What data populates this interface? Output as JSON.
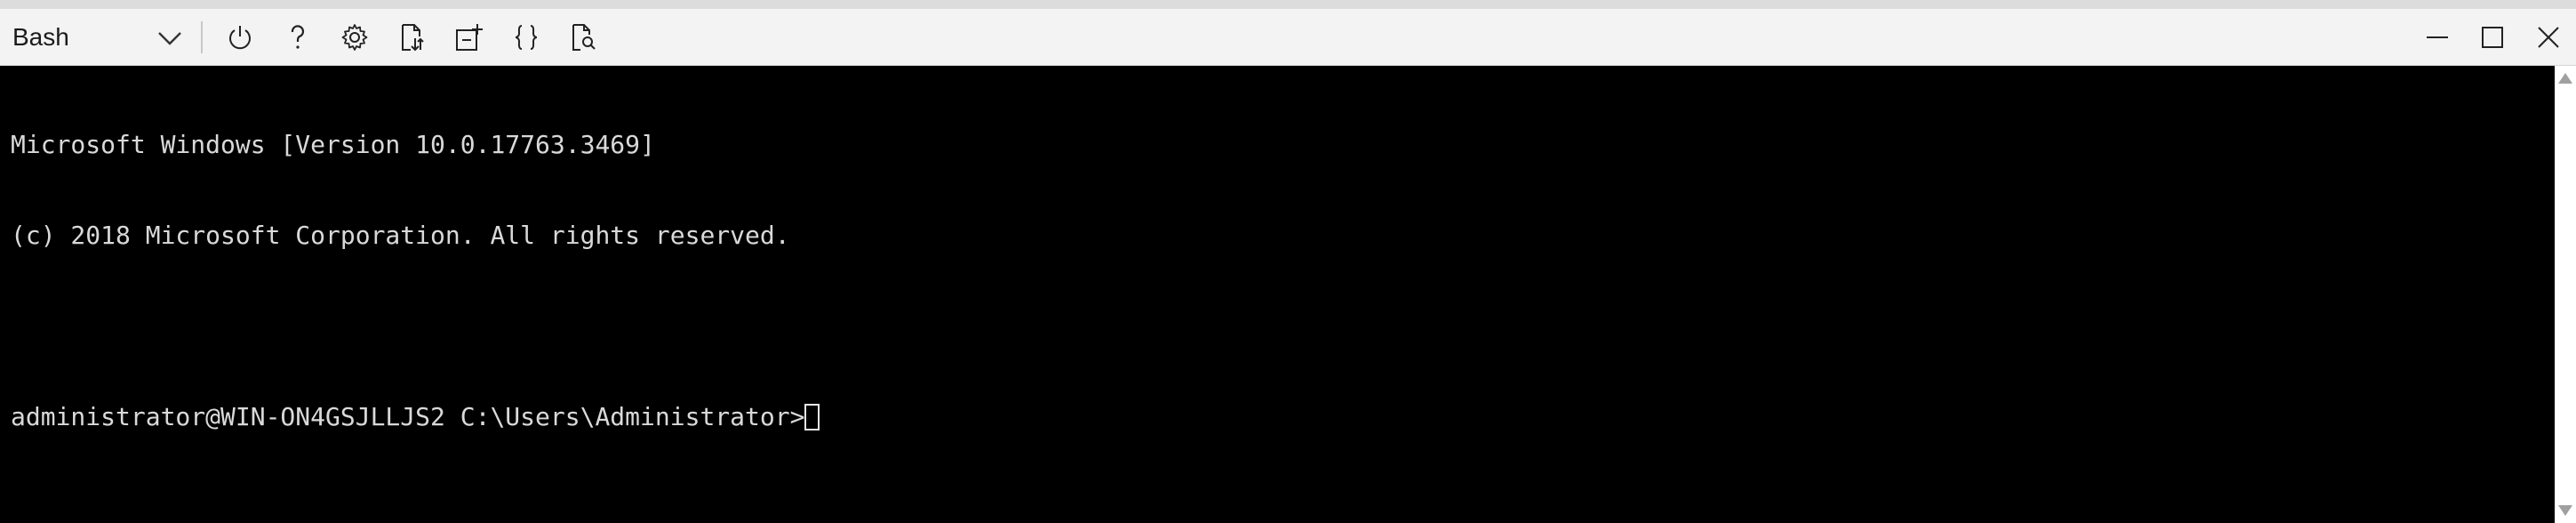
{
  "toolbar": {
    "shell_label": "Bash",
    "buttons": [
      {
        "icon": "power-icon"
      },
      {
        "icon": "help-icon"
      },
      {
        "icon": "gear-icon"
      },
      {
        "icon": "upload-download-icon"
      },
      {
        "icon": "new-session-icon"
      },
      {
        "icon": "braces-icon"
      },
      {
        "icon": "web-preview-icon"
      }
    ],
    "window_controls": [
      {
        "icon": "minimize-icon"
      },
      {
        "icon": "maximize-icon"
      },
      {
        "icon": "close-icon"
      }
    ]
  },
  "terminal": {
    "lines": [
      "Microsoft Windows [Version 10.0.17763.3469]",
      "(c) 2018 Microsoft Corporation. All rights reserved.",
      "",
      "administrator@WIN-ON4GSJLLJS2 C:\\Users\\Administrator>"
    ]
  },
  "colors": {
    "toolbar_bg": "#f3f3f3",
    "terminal_bg": "#000000",
    "terminal_fg": "#d9d9d9"
  }
}
